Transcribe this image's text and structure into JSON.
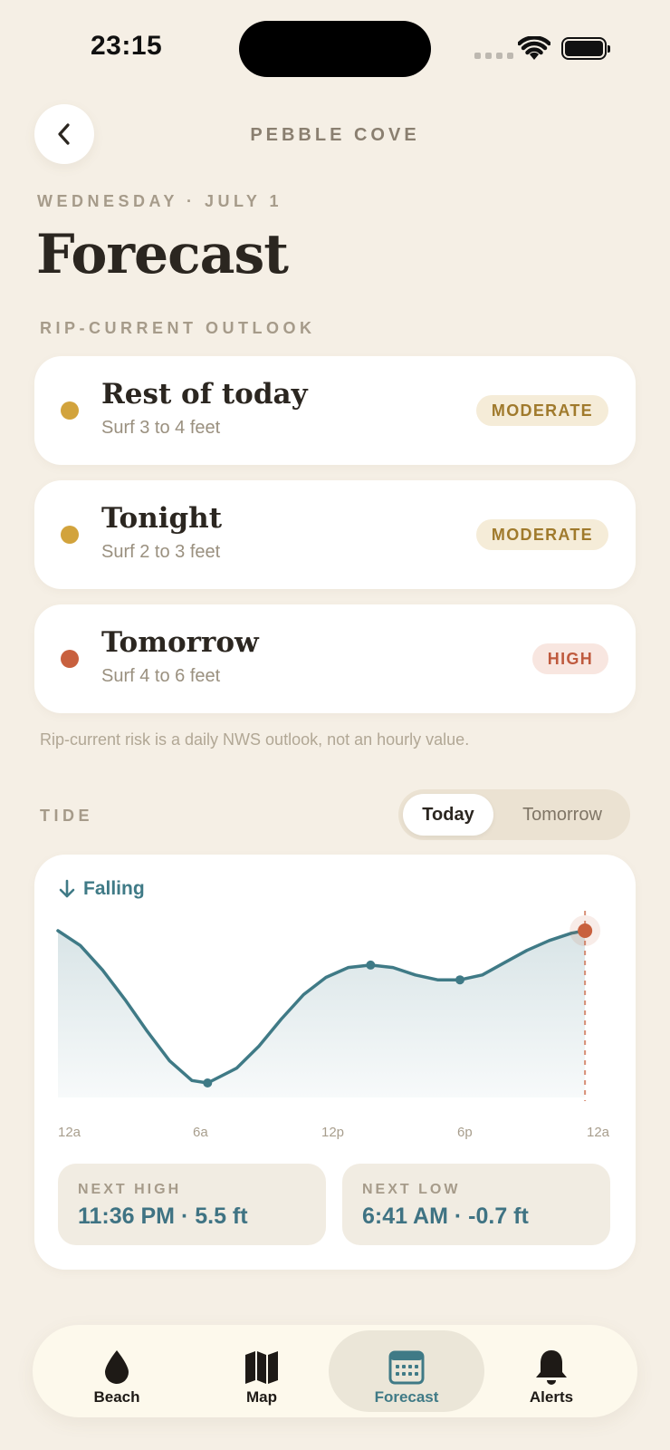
{
  "status_bar": {
    "time": "23:15"
  },
  "header": {
    "title": "PEBBLE COVE"
  },
  "date_label": "WEDNESDAY · JULY 1",
  "page_title": "Forecast",
  "outlook": {
    "label": "RIP-CURRENT OUTLOOK",
    "items": [
      {
        "period": "Rest of today",
        "surf": "Surf 3 to 4 feet",
        "risk": "MODERATE",
        "color": "#d2a33c"
      },
      {
        "period": "Tonight",
        "surf": "Surf 2 to 3 feet",
        "risk": "MODERATE",
        "color": "#d2a33c"
      },
      {
        "period": "Tomorrow",
        "surf": "Surf 4 to 6 feet",
        "risk": "HIGH",
        "color": "#c8603e"
      }
    ],
    "note": "Rip-current risk is a daily NWS outlook, not an hourly value."
  },
  "tide": {
    "label": "TIDE",
    "toggle": {
      "options": [
        "Today",
        "Tomorrow"
      ],
      "selected": "Today"
    },
    "trend": "Falling",
    "next_high": {
      "label": "NEXT HIGH",
      "value": "11:36 PM · 5.5 ft"
    },
    "next_low": {
      "label": "NEXT LOW",
      "value": "6:41 AM · -0.7 ft"
    }
  },
  "chart_data": {
    "type": "area",
    "x_ticks": [
      "12a",
      "6a",
      "12p",
      "6p",
      "12a"
    ],
    "x_range_hours": [
      0,
      24
    ],
    "y_units": "ft",
    "series": [
      {
        "x": [
          0,
          1,
          2,
          3,
          4,
          5,
          6,
          6.7,
          8,
          9,
          10,
          11,
          12,
          13,
          14,
          15,
          16,
          17,
          18,
          19,
          20,
          21,
          22,
          23,
          23.6
        ],
        "y": [
          5.5,
          4.9,
          3.9,
          2.7,
          1.4,
          0.2,
          -0.6,
          -0.7,
          -0.1,
          0.8,
          1.9,
          2.9,
          3.6,
          4.0,
          4.1,
          4.0,
          3.7,
          3.5,
          3.5,
          3.7,
          4.2,
          4.7,
          5.1,
          5.4,
          5.5
        ]
      }
    ],
    "markers": [
      {
        "x": 6.7,
        "y": -0.7,
        "kind": "low"
      },
      {
        "x": 14.0,
        "y": 4.1,
        "kind": "high"
      },
      {
        "x": 18.0,
        "y": 3.5,
        "kind": "low"
      }
    ],
    "now": {
      "x": 23.6,
      "y": 5.5
    },
    "colors": {
      "line": "#3f7a86",
      "now": "#c8603e"
    }
  },
  "tabbar": {
    "items": [
      {
        "label": "Beach",
        "icon": "water-drop-icon"
      },
      {
        "label": "Map",
        "icon": "map-icon"
      },
      {
        "label": "Forecast",
        "icon": "calendar-icon",
        "active": true
      },
      {
        "label": "Alerts",
        "icon": "bell-icon"
      }
    ]
  }
}
